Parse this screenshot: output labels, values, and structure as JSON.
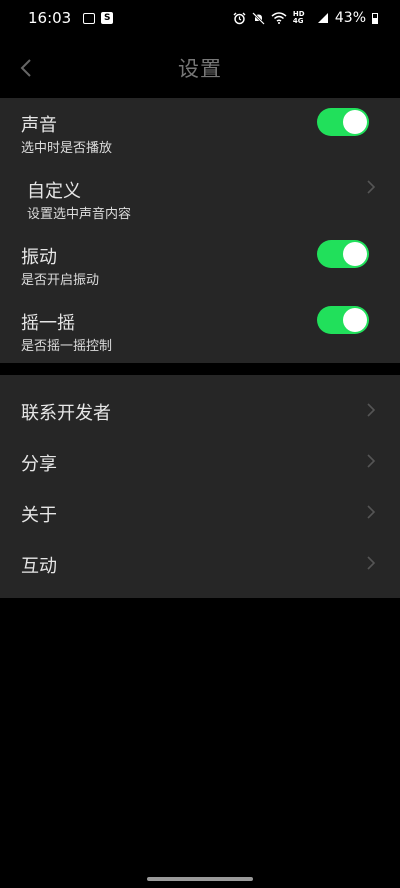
{
  "status_bar": {
    "time": "16:03",
    "battery": "43%",
    "network": "HD 4G",
    "left_icons": [
      "image-icon",
      "s-app-icon"
    ],
    "right_icons": [
      "alarm-icon",
      "mute-icon",
      "wifi-icon",
      "signal-icon",
      "battery-icon"
    ]
  },
  "header": {
    "title": "设置"
  },
  "settings_group_1": {
    "sound": {
      "title": "声音",
      "subtitle": "选中时是否播放",
      "enabled": true
    },
    "custom": {
      "title": "自定义",
      "subtitle": "设置选中声音内容"
    },
    "vibration": {
      "title": "振动",
      "subtitle": "是否开启振动",
      "enabled": true
    },
    "shake": {
      "title": "摇一摇",
      "subtitle": "是否摇一摇控制",
      "enabled": true
    }
  },
  "settings_group_2": {
    "items": [
      {
        "title": "联系开发者"
      },
      {
        "title": "分享"
      },
      {
        "title": "关于"
      },
      {
        "title": "互动"
      }
    ]
  },
  "colors": {
    "toggle_on": "#21e05b",
    "background": "#000000",
    "group_bg": "#262626"
  }
}
